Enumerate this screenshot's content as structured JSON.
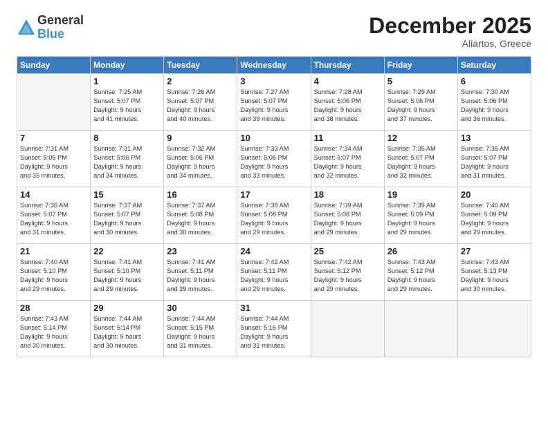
{
  "logo": {
    "general": "General",
    "blue": "Blue"
  },
  "title": "December 2025",
  "subtitle": "Aliartos, Greece",
  "headers": [
    "Sunday",
    "Monday",
    "Tuesday",
    "Wednesday",
    "Thursday",
    "Friday",
    "Saturday"
  ],
  "weeks": [
    [
      {
        "num": "",
        "info": ""
      },
      {
        "num": "1",
        "info": "Sunrise: 7:25 AM\nSunset: 5:07 PM\nDaylight: 9 hours\nand 41 minutes."
      },
      {
        "num": "2",
        "info": "Sunrise: 7:26 AM\nSunset: 5:07 PM\nDaylight: 9 hours\nand 40 minutes."
      },
      {
        "num": "3",
        "info": "Sunrise: 7:27 AM\nSunset: 5:07 PM\nDaylight: 9 hours\nand 39 minutes."
      },
      {
        "num": "4",
        "info": "Sunrise: 7:28 AM\nSunset: 5:06 PM\nDaylight: 9 hours\nand 38 minutes."
      },
      {
        "num": "5",
        "info": "Sunrise: 7:29 AM\nSunset: 5:06 PM\nDaylight: 9 hours\nand 37 minutes."
      },
      {
        "num": "6",
        "info": "Sunrise: 7:30 AM\nSunset: 5:06 PM\nDaylight: 9 hours\nand 36 minutes."
      }
    ],
    [
      {
        "num": "7",
        "info": "Sunrise: 7:31 AM\nSunset: 5:06 PM\nDaylight: 9 hours\nand 35 minutes."
      },
      {
        "num": "8",
        "info": "Sunrise: 7:31 AM\nSunset: 5:06 PM\nDaylight: 9 hours\nand 34 minutes."
      },
      {
        "num": "9",
        "info": "Sunrise: 7:32 AM\nSunset: 5:06 PM\nDaylight: 9 hours\nand 34 minutes."
      },
      {
        "num": "10",
        "info": "Sunrise: 7:33 AM\nSunset: 5:06 PM\nDaylight: 9 hours\nand 33 minutes."
      },
      {
        "num": "11",
        "info": "Sunrise: 7:34 AM\nSunset: 5:07 PM\nDaylight: 9 hours\nand 32 minutes."
      },
      {
        "num": "12",
        "info": "Sunrise: 7:35 AM\nSunset: 5:07 PM\nDaylight: 9 hours\nand 32 minutes."
      },
      {
        "num": "13",
        "info": "Sunrise: 7:35 AM\nSunset: 5:07 PM\nDaylight: 9 hours\nand 31 minutes."
      }
    ],
    [
      {
        "num": "14",
        "info": "Sunrise: 7:36 AM\nSunset: 5:07 PM\nDaylight: 9 hours\nand 31 minutes."
      },
      {
        "num": "15",
        "info": "Sunrise: 7:37 AM\nSunset: 5:07 PM\nDaylight: 9 hours\nand 30 minutes."
      },
      {
        "num": "16",
        "info": "Sunrise: 7:37 AM\nSunset: 5:08 PM\nDaylight: 9 hours\nand 30 minutes."
      },
      {
        "num": "17",
        "info": "Sunrise: 7:38 AM\nSunset: 5:08 PM\nDaylight: 9 hours\nand 29 minutes."
      },
      {
        "num": "18",
        "info": "Sunrise: 7:39 AM\nSunset: 5:08 PM\nDaylight: 9 hours\nand 29 minutes."
      },
      {
        "num": "19",
        "info": "Sunrise: 7:39 AM\nSunset: 5:09 PM\nDaylight: 9 hours\nand 29 minutes."
      },
      {
        "num": "20",
        "info": "Sunrise: 7:40 AM\nSunset: 5:09 PM\nDaylight: 9 hours\nand 29 minutes."
      }
    ],
    [
      {
        "num": "21",
        "info": "Sunrise: 7:40 AM\nSunset: 5:10 PM\nDaylight: 9 hours\nand 29 minutes."
      },
      {
        "num": "22",
        "info": "Sunrise: 7:41 AM\nSunset: 5:10 PM\nDaylight: 9 hours\nand 29 minutes."
      },
      {
        "num": "23",
        "info": "Sunrise: 7:41 AM\nSunset: 5:11 PM\nDaylight: 9 hours\nand 29 minutes."
      },
      {
        "num": "24",
        "info": "Sunrise: 7:42 AM\nSunset: 5:11 PM\nDaylight: 9 hours\nand 29 minutes."
      },
      {
        "num": "25",
        "info": "Sunrise: 7:42 AM\nSunset: 5:12 PM\nDaylight: 9 hours\nand 29 minutes."
      },
      {
        "num": "26",
        "info": "Sunrise: 7:43 AM\nSunset: 5:12 PM\nDaylight: 9 hours\nand 29 minutes."
      },
      {
        "num": "27",
        "info": "Sunrise: 7:43 AM\nSunset: 5:13 PM\nDaylight: 9 hours\nand 30 minutes."
      }
    ],
    [
      {
        "num": "28",
        "info": "Sunrise: 7:43 AM\nSunset: 5:14 PM\nDaylight: 9 hours\nand 30 minutes."
      },
      {
        "num": "29",
        "info": "Sunrise: 7:44 AM\nSunset: 5:14 PM\nDaylight: 9 hours\nand 30 minutes."
      },
      {
        "num": "30",
        "info": "Sunrise: 7:44 AM\nSunset: 5:15 PM\nDaylight: 9 hours\nand 31 minutes."
      },
      {
        "num": "31",
        "info": "Sunrise: 7:44 AM\nSunset: 5:16 PM\nDaylight: 9 hours\nand 31 minutes."
      },
      {
        "num": "",
        "info": ""
      },
      {
        "num": "",
        "info": ""
      },
      {
        "num": "",
        "info": ""
      }
    ]
  ]
}
